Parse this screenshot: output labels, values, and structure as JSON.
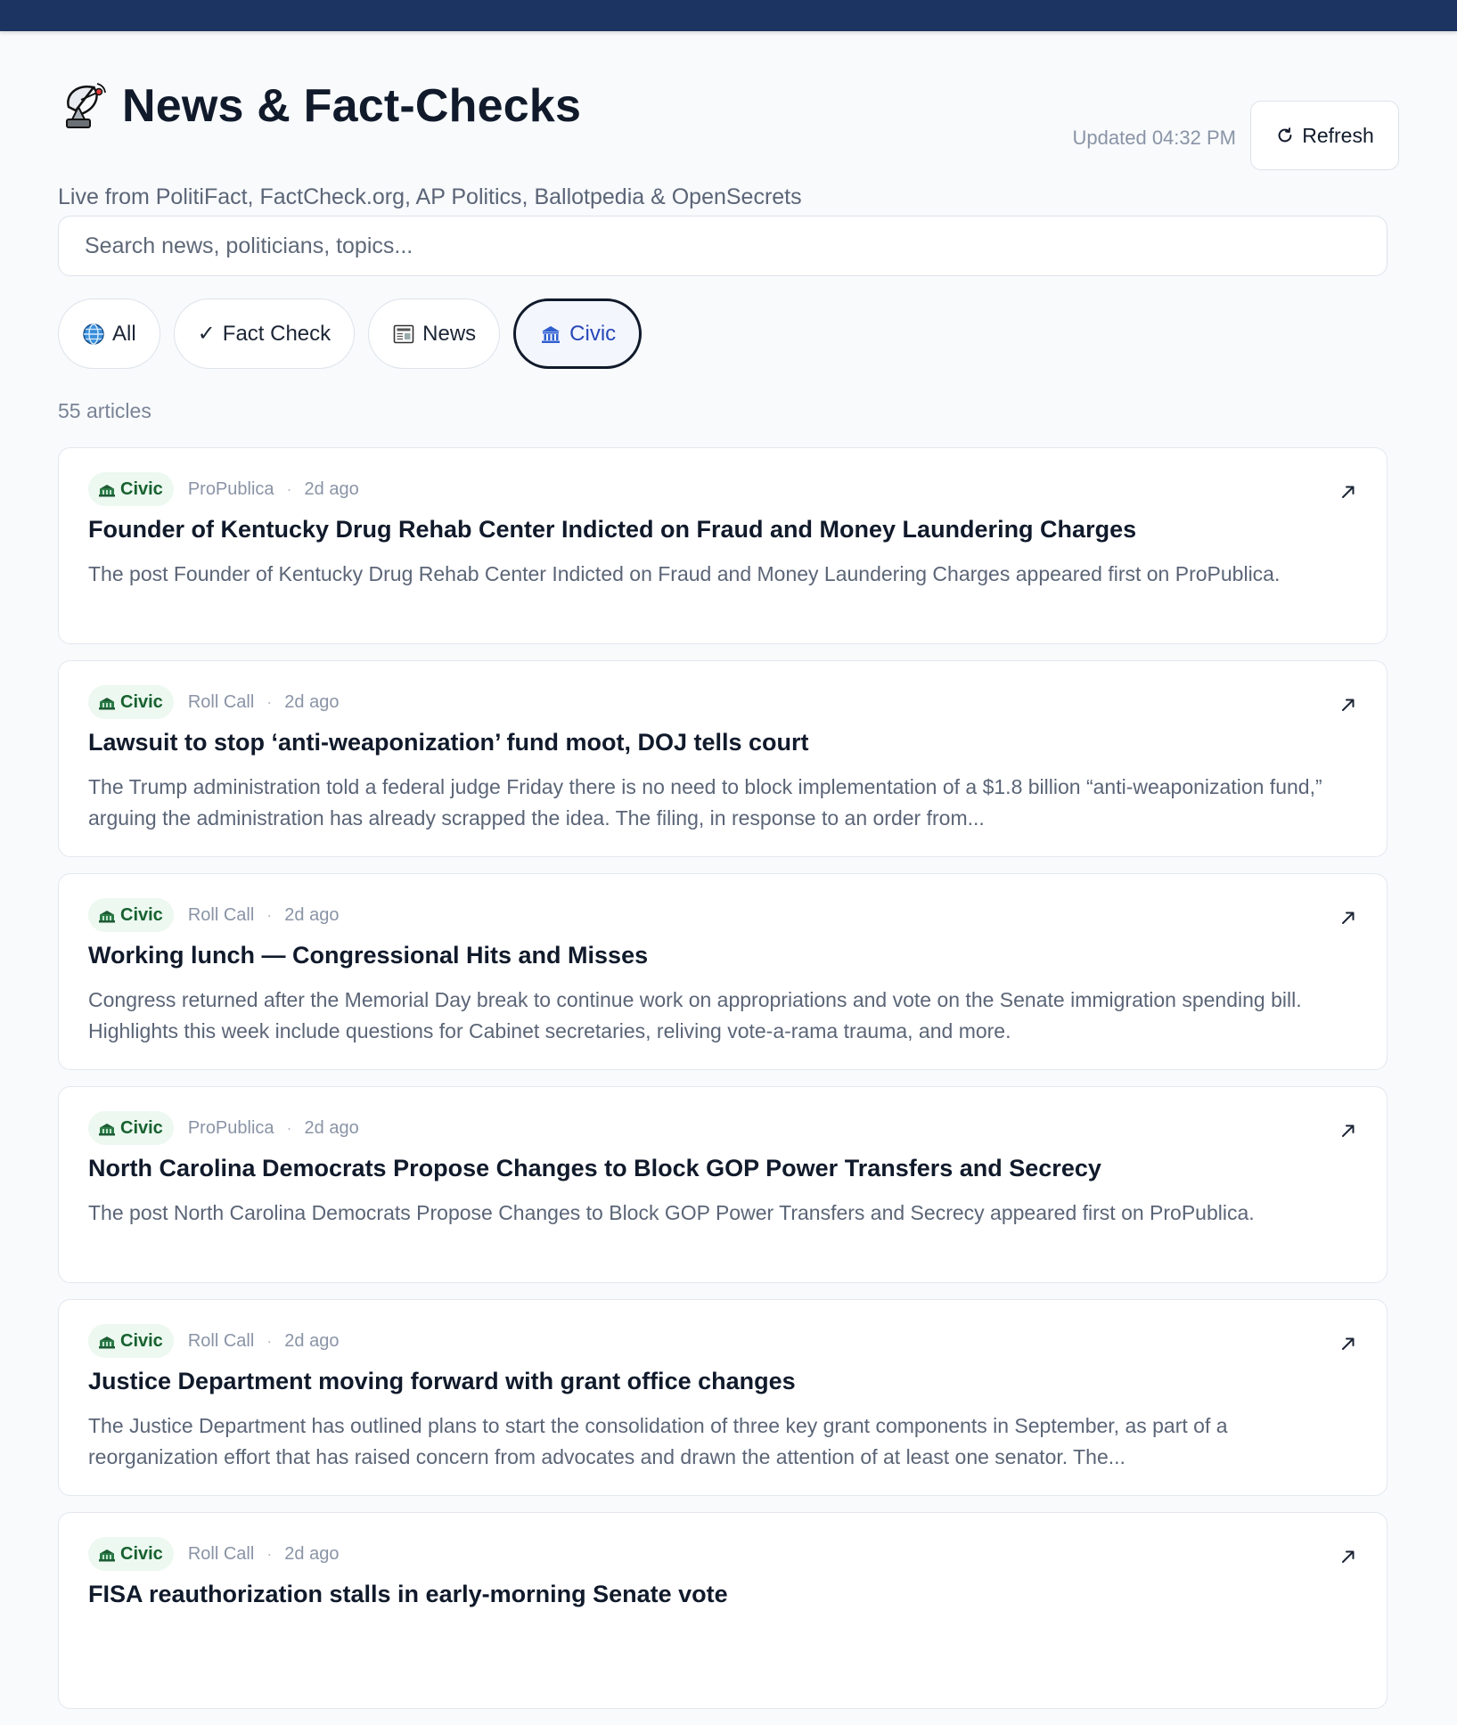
{
  "header": {
    "title": "News & Fact-Checks",
    "subtitle": "Live from PolitiFact, FactCheck.org, AP Politics, Ballotpedia & OpenSecrets",
    "updated": "Updated 04:32 PM",
    "refresh_label": "Refresh",
    "title_icon": "satellite-dish-icon"
  },
  "search": {
    "placeholder": "Search news, politicians, topics..."
  },
  "filters": [
    {
      "label": "All",
      "icon": "globe-icon",
      "active": false
    },
    {
      "label": "Fact Check",
      "icon": "checkmark",
      "active": false
    },
    {
      "label": "News",
      "icon": "newspaper-icon",
      "active": false
    },
    {
      "label": "Civic",
      "icon": "building-icon",
      "active": true
    }
  ],
  "article_count": "55 articles",
  "colors": {
    "topbar": "#1b3461",
    "badge_bg": "#ecf8f0",
    "badge_text": "#17612f",
    "active_chip_text": "#2747b8"
  },
  "articles": [
    {
      "category": "Civic",
      "source": "ProPublica",
      "time": "2d ago",
      "title": "Founder of Kentucky Drug Rehab Center Indicted on Fraud and Money Laundering Charges",
      "description": "The post Founder of Kentucky Drug Rehab Center Indicted on Fraud and Money Laundering Charges appeared first on ProPublica."
    },
    {
      "category": "Civic",
      "source": "Roll Call",
      "time": "2d ago",
      "title": "Lawsuit to stop ‘anti-weaponization’ fund moot, DOJ tells court",
      "description": "The Trump administration told a federal judge Friday there is no need to block implementation of a $1.8 billion “anti-weaponization fund,” arguing the administration has already scrapped the idea. The filing, in response to an order from..."
    },
    {
      "category": "Civic",
      "source": "Roll Call",
      "time": "2d ago",
      "title": "Working lunch  — Congressional Hits and Misses",
      "description": "Congress returned after the Memorial Day break to continue work on appropriations and vote on the Senate immigration spending bill. Highlights this week include questions for Cabinet secretaries, reliving vote-a-rama trauma, and more."
    },
    {
      "category": "Civic",
      "source": "ProPublica",
      "time": "2d ago",
      "title": "North Carolina Democrats Propose Changes to Block GOP Power Transfers and Secrecy",
      "description": "The post North Carolina Democrats Propose Changes to Block GOP Power Transfers and Secrecy appeared first on ProPublica."
    },
    {
      "category": "Civic",
      "source": "Roll Call",
      "time": "2d ago",
      "title": "Justice Department moving forward with grant office changes",
      "description": "The Justice Department has outlined plans to start the consolidation of three key grant components in September, as part of a reorganization effort that has raised concern from advocates and drawn the attention of at least one senator. The..."
    },
    {
      "category": "Civic",
      "source": "Roll Call",
      "time": "2d ago",
      "title": "FISA reauthorization stalls in early-morning Senate vote",
      "description": ""
    }
  ]
}
